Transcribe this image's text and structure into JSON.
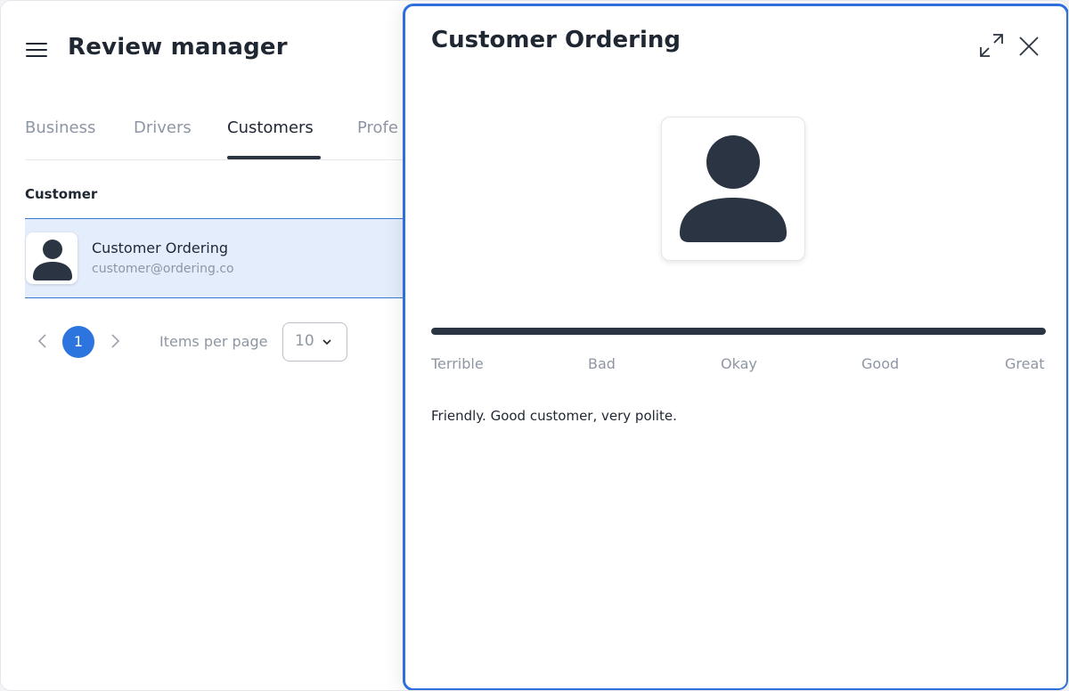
{
  "header": {
    "title": "Review manager"
  },
  "tabs": [
    {
      "label": "Business"
    },
    {
      "label": "Drivers"
    },
    {
      "label": "Customers",
      "active": true
    },
    {
      "label": "Profe"
    }
  ],
  "table": {
    "column_header": "Customer",
    "rows": [
      {
        "name": "Customer Ordering",
        "email": "customer@ordering.co",
        "selected": true
      }
    ]
  },
  "pagination": {
    "current_page": "1",
    "items_per_page_label": "Items per page",
    "items_per_page_value": "10"
  },
  "panel": {
    "title": "Customer Ordering",
    "rating": {
      "labels": [
        "Terrible",
        "Bad",
        "Okay",
        "Good",
        "Great"
      ],
      "value_fraction": 1.0
    },
    "comment": "Friendly. Good customer, very polite."
  },
  "colors": {
    "accent": "#2c74de",
    "panel_border": "#2f6fdb",
    "selected_row_bg": "#e3edfb",
    "dark": "#2b3442"
  },
  "icons": {
    "menu": "hamburger-icon",
    "avatar": "user-icon",
    "expand": "expand-icon",
    "close": "close-icon",
    "prev": "chevron-left-icon",
    "next": "chevron-right-icon",
    "dropdown": "chevron-down-icon"
  }
}
